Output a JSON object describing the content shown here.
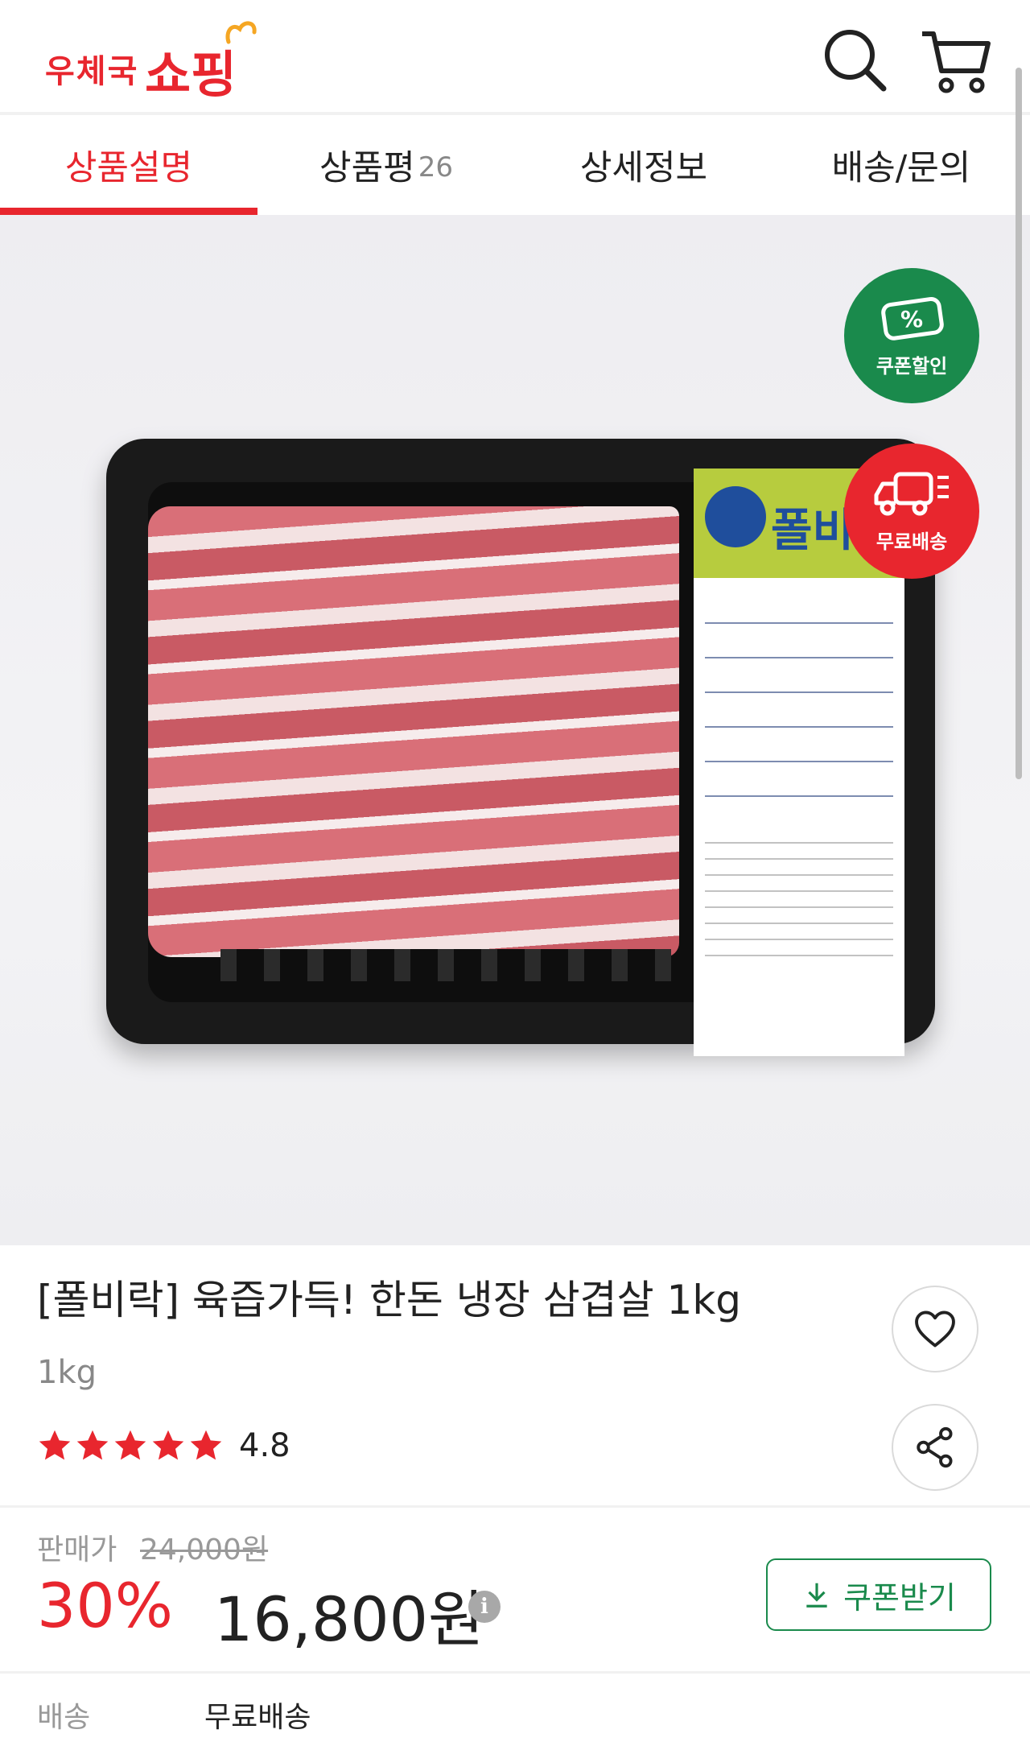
{
  "header": {
    "logo_small": "우체국",
    "logo_big": "쇼핑",
    "search_icon": "search-icon",
    "cart_icon": "cart-icon"
  },
  "tabs": [
    {
      "label": "상품설명",
      "count": "",
      "active": true
    },
    {
      "label": "상품평",
      "count": "26",
      "active": false
    },
    {
      "label": "상세정보",
      "count": "",
      "active": false
    },
    {
      "label": "배송/문의",
      "count": "",
      "active": false
    }
  ],
  "hero": {
    "badges": {
      "coupon": "쿠폰할인",
      "shipping": "무료배송"
    },
    "label_brand": "폴비락"
  },
  "product": {
    "title": "[폴비락] 육즙가득! 한돈 냉장 삼겹살 1kg",
    "option": "1kg",
    "rating": "4.8",
    "stars": 5
  },
  "price": {
    "label": "판매가",
    "original": "24,000원",
    "discount": "30%",
    "sale": "16,800원",
    "coupon_button": "쿠폰받기"
  },
  "shipping": {
    "label": "배송",
    "value": "무료배송"
  },
  "colors": {
    "brand_red": "#e8262e",
    "coupon_green": "#1a8a4c"
  }
}
